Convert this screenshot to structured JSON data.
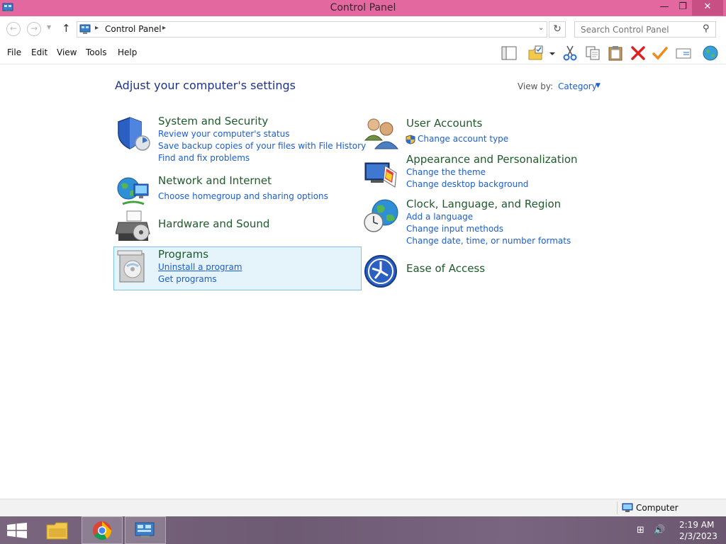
{
  "window": {
    "title": "Control Panel",
    "min_glyph": "—",
    "max_glyph": "❐",
    "close_glyph": "✕"
  },
  "address": {
    "back_glyph": "←",
    "forward_glyph": "→",
    "history_glyph": "▼",
    "up_glyph": "↑",
    "separator_glyph": "▸",
    "breadcrumb": "Control Panel",
    "dropdown_glyph": "⌄",
    "refresh_glyph": "↻",
    "search_placeholder": "Search Control Panel",
    "search_glyph": "⚲"
  },
  "menu": {
    "items": [
      "File",
      "Edit",
      "View",
      "Tools",
      "Help"
    ]
  },
  "toolbar": {
    "icons": [
      "layout-icon",
      "folder-check-icon",
      "cut-icon",
      "copy-icon",
      "paste-icon",
      "delete-icon",
      "check-icon",
      "email-icon",
      "globe-icon"
    ]
  },
  "main": {
    "title": "Adjust your computer's settings",
    "view_by_label": "View by:",
    "view_by_value": "Category",
    "view_by_caret": "▼",
    "categories": {
      "system_security": {
        "title": "System and Security",
        "links": [
          "Review your computer's status",
          "Save backup copies of your files with File History",
          "Find and fix problems"
        ]
      },
      "network": {
        "title": "Network and Internet",
        "links": [
          "Choose homegroup and sharing options"
        ]
      },
      "hardware": {
        "title": "Hardware and Sound"
      },
      "programs": {
        "title": "Programs",
        "links": [
          "Uninstall a program",
          "Get programs"
        ]
      },
      "user_accounts": {
        "title": "User Accounts",
        "links": [
          "Change account type"
        ]
      },
      "appearance": {
        "title": "Appearance and Personalization",
        "links": [
          "Change the theme",
          "Change desktop background"
        ]
      },
      "clock": {
        "title": "Clock, Language, and Region",
        "links": [
          "Add a language",
          "Change input methods",
          "Change date, time, or number formats"
        ]
      },
      "ease": {
        "title": "Ease of Access"
      }
    }
  },
  "statusbar": {
    "location": "Computer"
  },
  "taskbar": {
    "tray_network_glyph": "⊞",
    "tray_volume_glyph": "🔊",
    "time": "2:19 AM",
    "date": "2/3/2023"
  },
  "colors": {
    "titlebar": "#e468a0",
    "heading": "#1e5a2a",
    "link": "#1c5ecf",
    "page_title": "#1e3287"
  }
}
